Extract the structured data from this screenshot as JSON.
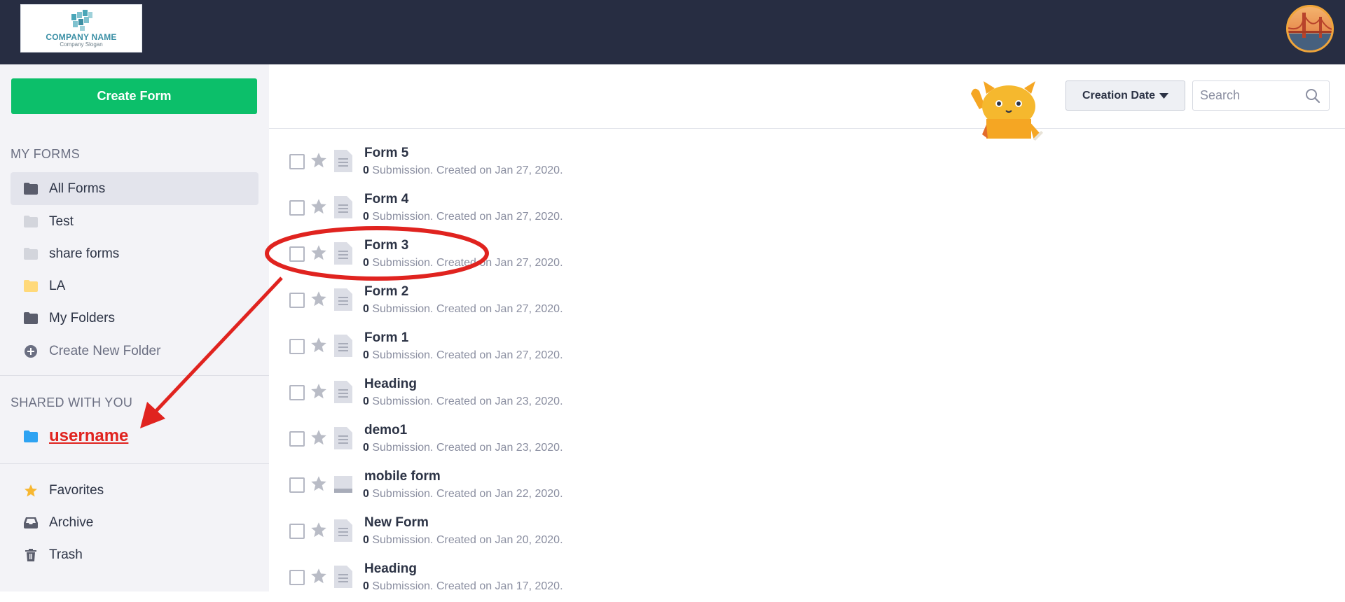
{
  "header": {
    "logo": {
      "name": "COMPANY NAME",
      "slogan": "Company Slogan"
    },
    "avatar_icon": "user-avatar-photo"
  },
  "sidebar": {
    "create_button": "Create Form",
    "my_forms_title": "MY FORMS",
    "my_forms_items": [
      {
        "label": "All Forms",
        "icon": "folder-icon",
        "color": "#5a5d6c",
        "active": true
      },
      {
        "label": "Test",
        "icon": "folder-icon",
        "color": "#d3d5dc"
      },
      {
        "label": "share forms",
        "icon": "folder-icon",
        "color": "#d3d5dc"
      },
      {
        "label": "LA",
        "icon": "folder-icon",
        "color": "#ffd97a"
      },
      {
        "label": "My Folders",
        "icon": "folder-icon",
        "color": "#5a5d6c"
      },
      {
        "label": "Create New Folder",
        "icon": "plus-circle-icon",
        "color": "#6b6f82"
      }
    ],
    "shared_title": "SHARED WITH YOU",
    "shared_item": {
      "label": "username",
      "icon": "folder-icon",
      "color": "#2ea3f2"
    },
    "bottom_items": [
      {
        "label": "Favorites",
        "icon": "star-icon",
        "color": "#f7b731"
      },
      {
        "label": "Archive",
        "icon": "inbox-icon",
        "color": "#5a5d6c"
      },
      {
        "label": "Trash",
        "icon": "trash-icon",
        "color": "#5a5d6c"
      }
    ]
  },
  "toolbar": {
    "sort_label": "Creation Date",
    "search_placeholder": "Search"
  },
  "forms": [
    {
      "title": "Form 5",
      "count": "0",
      "meta": " Submission. Created on Jan 27, 2020."
    },
    {
      "title": "Form 4",
      "count": "0",
      "meta": " Submission. Created on Jan 27, 2020."
    },
    {
      "title": "Form 3",
      "count": "0",
      "meta": " Submission. Created on Jan 27, 2020."
    },
    {
      "title": "Form 2",
      "count": "0",
      "meta": " Submission. Created on Jan 27, 2020."
    },
    {
      "title": "Form 1",
      "count": "0",
      "meta": " Submission. Created on Jan 27, 2020."
    },
    {
      "title": "Heading",
      "count": "0",
      "meta": " Submission. Created on Jan 23, 2020."
    },
    {
      "title": "demo1",
      "count": "0",
      "meta": " Submission. Created on Jan 23, 2020."
    },
    {
      "title": "mobile form",
      "count": "0",
      "meta": " Submission. Created on Jan 22, 2020."
    },
    {
      "title": "New Form",
      "count": "0",
      "meta": " Submission. Created on Jan 20, 2020."
    },
    {
      "title": "Heading",
      "count": "0",
      "meta": " Submission. Created on Jan 17, 2020."
    }
  ],
  "colors": {
    "topbar": "#272d42",
    "accent_green": "#0cbf6a",
    "annotation_red": "#e0231f"
  }
}
